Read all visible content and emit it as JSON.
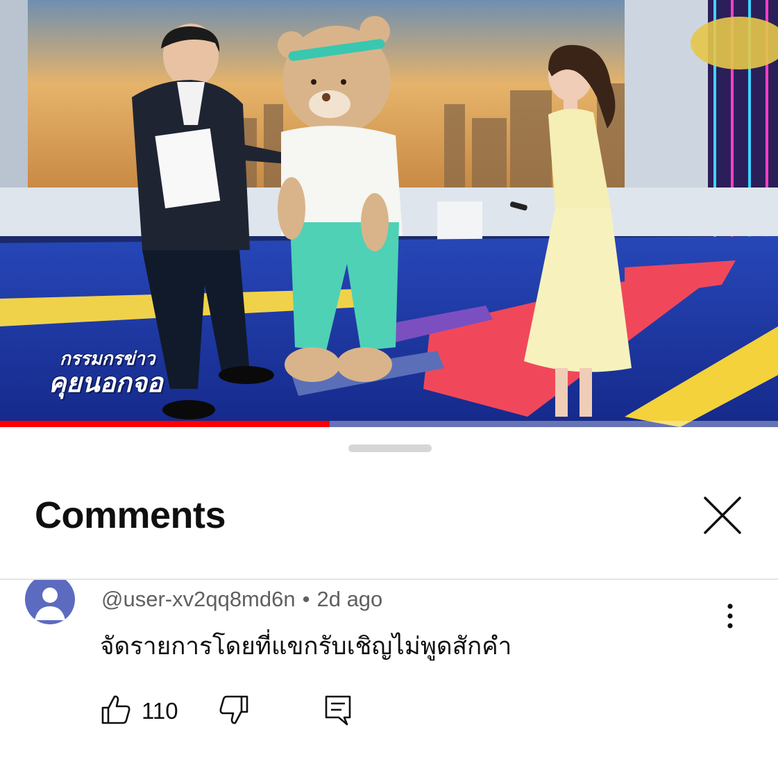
{
  "video": {
    "overlay_title_line1": "กรรมกรข่าว",
    "overlay_title_line2": "คุยนอกจอ",
    "progress": 0.424,
    "colors": {
      "progress_played": "#ff0000",
      "floor_blue": "#1e3aa8",
      "floor_red": "#f0485a",
      "floor_yellow": "#f3d23c",
      "sky_orange": "#e8a24a"
    }
  },
  "comments_panel": {
    "title": "Comments",
    "close_icon": "close-icon"
  },
  "comments": [
    {
      "author": "@user-xv2qq8md6n",
      "separator": "•",
      "time": "2d ago",
      "text": "จัดรายการโดยที่แขกรับเชิญไม่พูดสักคำ",
      "likes": "110",
      "avatar_color": "#5c6bc0",
      "icons": {
        "avatar": "default-avatar-icon",
        "more": "more-vertical-icon",
        "like": "thumbs-up-icon",
        "dislike": "thumbs-down-icon",
        "reply": "reply-icon"
      }
    }
  ]
}
